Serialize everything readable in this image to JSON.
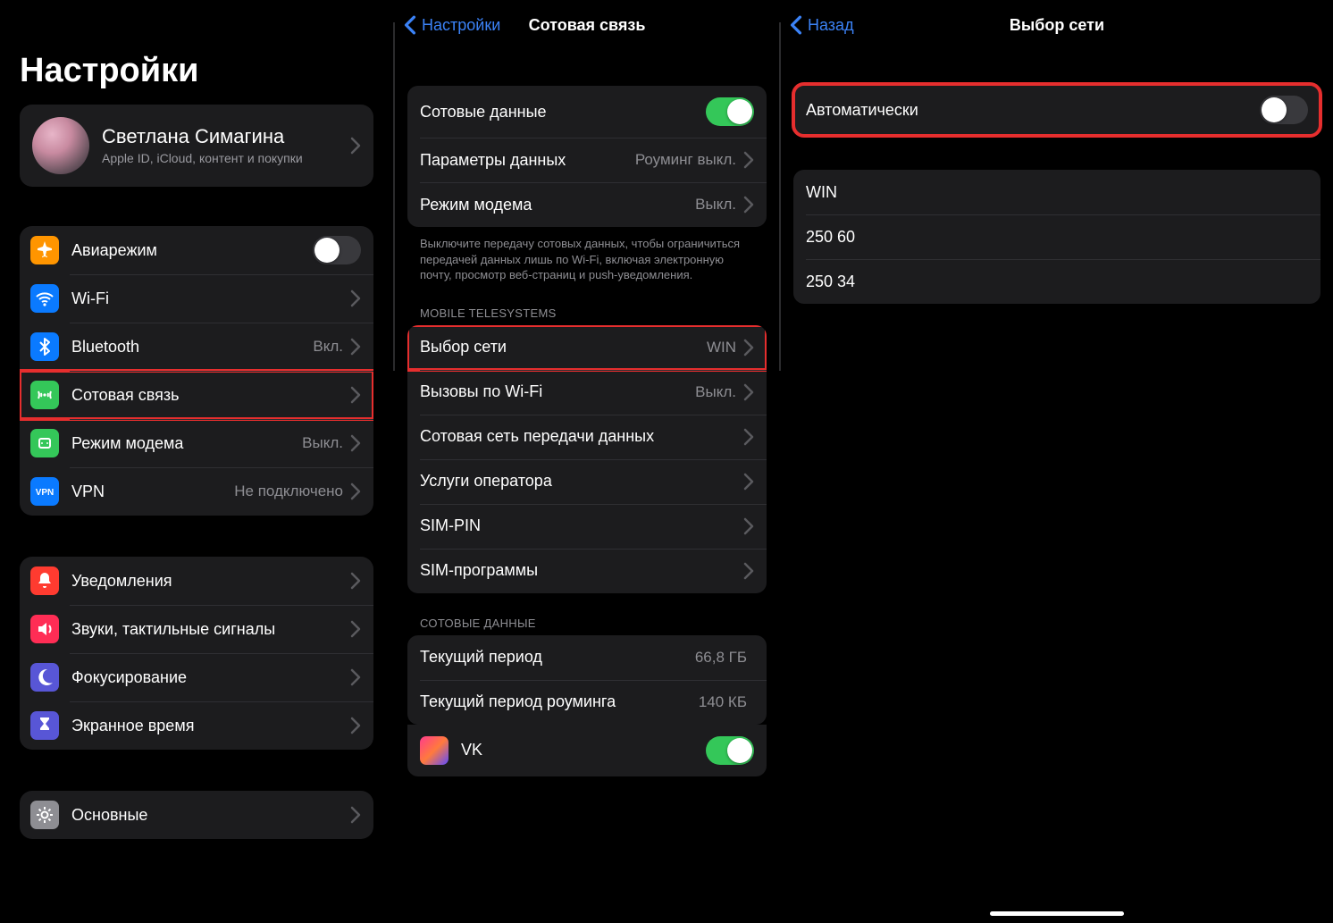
{
  "pane1": {
    "title": "Настройки",
    "profile": {
      "name": "Светлана Симагина",
      "sub": "Apple ID, iCloud, контент и покупки"
    },
    "group1": [
      {
        "label": "Авиарежим",
        "icon": "airplane",
        "color": "#ff9500",
        "toggle": false
      },
      {
        "label": "Wi-Fi",
        "icon": "wifi",
        "color": "#0a7aff",
        "chevron": true
      },
      {
        "label": "Bluetooth",
        "icon": "bluetooth",
        "color": "#0a7aff",
        "value": "Вкл.",
        "chevron": true
      },
      {
        "label": "Сотовая связь",
        "icon": "cellular",
        "color": "#34c759",
        "chevron": true,
        "highlight": true
      },
      {
        "label": "Режим модема",
        "icon": "hotspot",
        "color": "#34c759",
        "value": "Выкл.",
        "chevron": true
      },
      {
        "label": "VPN",
        "icon": "vpn",
        "color": "#0a7aff",
        "value": "Не подключено",
        "chevron": true
      }
    ],
    "group2": [
      {
        "label": "Уведомления",
        "icon": "bell",
        "color": "#ff3b30",
        "chevron": true
      },
      {
        "label": "Звуки, тактильные сигналы",
        "icon": "sound",
        "color": "#ff2d55",
        "chevron": true
      },
      {
        "label": "Фокусирование",
        "icon": "moon",
        "color": "#5856d6",
        "chevron": true
      },
      {
        "label": "Экранное время",
        "icon": "hourglass",
        "color": "#5856d6",
        "chevron": true
      }
    ],
    "group3": [
      {
        "label": "Основные",
        "icon": "gear",
        "color": "#8e8e93",
        "chevron": true
      }
    ]
  },
  "pane2": {
    "back": "Настройки",
    "title": "Сотовая связь",
    "group1": [
      {
        "label": "Сотовые данные",
        "toggle": true
      },
      {
        "label": "Параметры данных",
        "value": "Роуминг выкл.",
        "chevron": true
      },
      {
        "label": "Режим модема",
        "value": "Выкл.",
        "chevron": true
      }
    ],
    "note1": "Выключите передачу сотовых данных, чтобы ограничиться передачей данных лишь по Wi-Fi, включая электронную почту, просмотр веб-страниц и push-уведомления.",
    "carrier_header": "MOBILE TELESYSTEMS",
    "group2": [
      {
        "label": "Выбор сети",
        "value": "WIN",
        "chevron": true,
        "highlight": true
      },
      {
        "label": "Вызовы по Wi-Fi",
        "value": "Выкл.",
        "chevron": true
      },
      {
        "label": "Сотовая сеть передачи данных",
        "chevron": true
      },
      {
        "label": "Услуги оператора",
        "chevron": true
      },
      {
        "label": "SIM-PIN",
        "chevron": true
      },
      {
        "label": "SIM-программы",
        "chevron": true
      }
    ],
    "data_header": "СОТОВЫЕ ДАННЫЕ",
    "group3": [
      {
        "label": "Текущий период",
        "value": "66,8 ГБ"
      },
      {
        "label": "Текущий период роуминга",
        "value": "140 КБ"
      }
    ],
    "app": {
      "label": "VK",
      "toggle": true
    }
  },
  "pane3": {
    "back": "Назад",
    "title": "Выбор сети",
    "auto": {
      "label": "Автоматически",
      "toggle": false,
      "highlight": true
    },
    "networks": [
      {
        "label": "WIN"
      },
      {
        "label": "250 60"
      },
      {
        "label": "250 34"
      }
    ]
  }
}
